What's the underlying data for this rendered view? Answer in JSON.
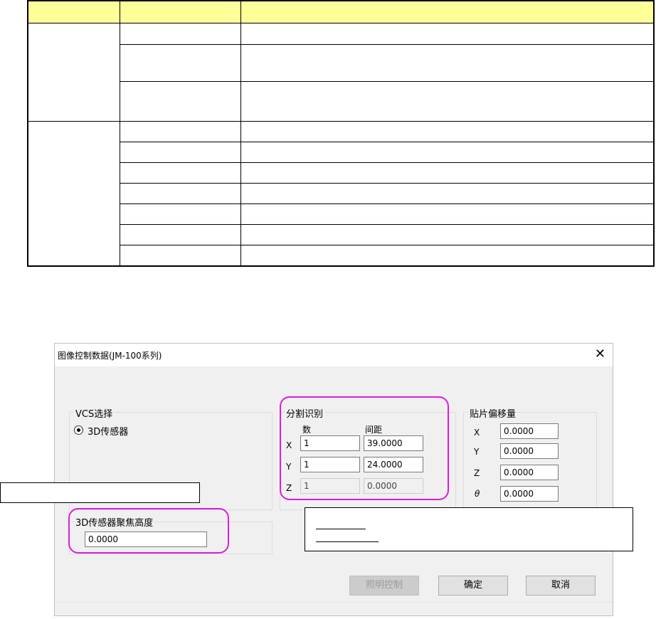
{
  "dialog": {
    "title": "图像控制数据(JM-100系列)",
    "vcs_group": {
      "label": "VCS选择",
      "radio_label": "3D传感器"
    },
    "split_group": {
      "label": "分割识别",
      "col_count": "数",
      "col_pitch": "间距",
      "rows": [
        {
          "axis": "X",
          "count": "1",
          "pitch": "39.0000",
          "enabled": true
        },
        {
          "axis": "Y",
          "count": "1",
          "pitch": "24.0000",
          "enabled": true
        },
        {
          "axis": "Z",
          "count": "1",
          "pitch": "0.0000",
          "enabled": false
        }
      ]
    },
    "offset_group": {
      "label": "贴片偏移量",
      "rows": [
        {
          "axis": "X",
          "value": "0.0000"
        },
        {
          "axis": "Y",
          "value": "0.0000"
        },
        {
          "axis": "Z",
          "value": "0.0000"
        },
        {
          "axis": "θ",
          "value": "0.0000"
        }
      ]
    },
    "focus_group": {
      "label": "3D传感器聚焦高度",
      "value": "0.0000"
    },
    "buttons": {
      "lighting": "照明控制",
      "ok": "确定",
      "cancel": "取消"
    }
  },
  "colors": {
    "table_header": "#ffff99",
    "highlight": "#e01be0"
  }
}
